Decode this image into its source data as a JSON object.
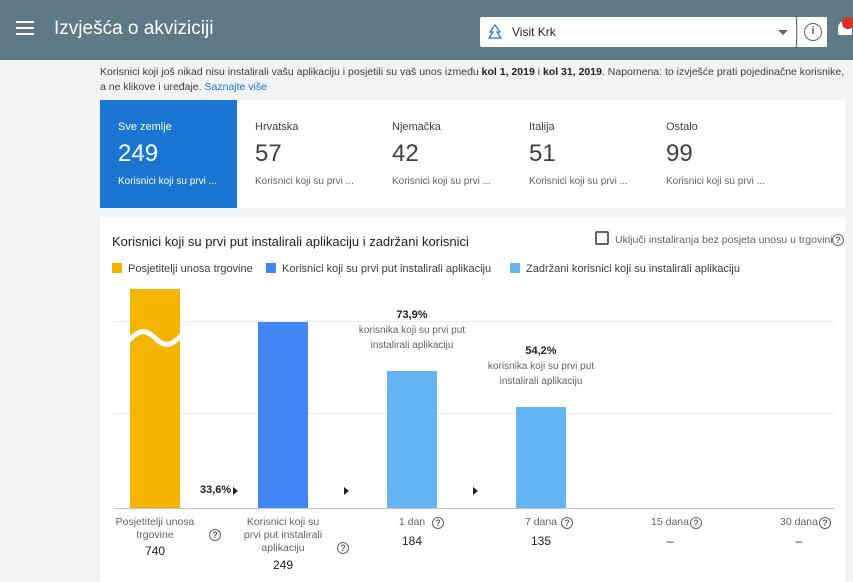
{
  "header": {
    "title": "Izvješća o akviziciji",
    "app_name": "Visit Krk",
    "info_icon_glyph": "i",
    "colors": {
      "bar_bg": "#5f7987",
      "notification": "#d93025"
    }
  },
  "notice": {
    "text_before": "Korisnici koji još nikad nisu instalirali vašu aplikaciju i posjetili su vaš unos između ",
    "date_from": "kol 1, 2019",
    "between": " i ",
    "date_to": "kol 31, 2019",
    "text_after": ". Napomena: to izvješće prati pojedinačne korisnike, a ne klikove i uređaje. ",
    "learn_more": "Saznajte više"
  },
  "cards": [
    {
      "label": "Sve zemlje",
      "value": "249",
      "desc": "Korisnici koji su prvi ..."
    },
    {
      "label": "Hrvatska",
      "value": "57",
      "desc": "Korisnici koji su prvi ..."
    },
    {
      "label": "Njemačka",
      "value": "42",
      "desc": "Korisnici koji su prvi ..."
    },
    {
      "label": "Italija",
      "value": "51",
      "desc": "Korisnici koji su prvi ..."
    },
    {
      "label": "Ostalo",
      "value": "99",
      "desc": "Korisnici koji su prvi ..."
    }
  ],
  "panel": {
    "title": "Korisnici koji su prvi put instalirali aplikaciju i zadržani korisnici",
    "checkbox_label": "Uključi instaliranja bez posjeta unosu u trgovini",
    "help_glyph": "?"
  },
  "chart_data": {
    "type": "bar",
    "series": [
      {
        "name": "Posjetitelji unosa trgovine",
        "color": "#f4b400"
      },
      {
        "name": "Korisnici koji su prvi put instalirali aplikaciju",
        "color": "#4285f4"
      },
      {
        "name": "Zadržani korisnici koji su instalirali aplikaciju",
        "color": "#64b5f6"
      }
    ],
    "categories": [
      "Posjetitelji unosa trgovine",
      "Korisnici koji su prvi put instalirali aplikaciju",
      "1 dan",
      "7 dana",
      "15 dana",
      "30 dana"
    ],
    "values": [
      740,
      249,
      184,
      135,
      null,
      null
    ],
    "value_labels": [
      "740",
      "249",
      "184",
      "135",
      "–",
      "–"
    ],
    "conversion_label": "33,6%",
    "retention": [
      {
        "percent": "73,9%",
        "desc": "korisnika koji su prvi put instalirali aplikaciju"
      },
      {
        "percent": "54,2%",
        "desc": "korisnika koji su prvi put instalirali aplikaciju"
      }
    ],
    "first_bar_axis_break": true
  }
}
